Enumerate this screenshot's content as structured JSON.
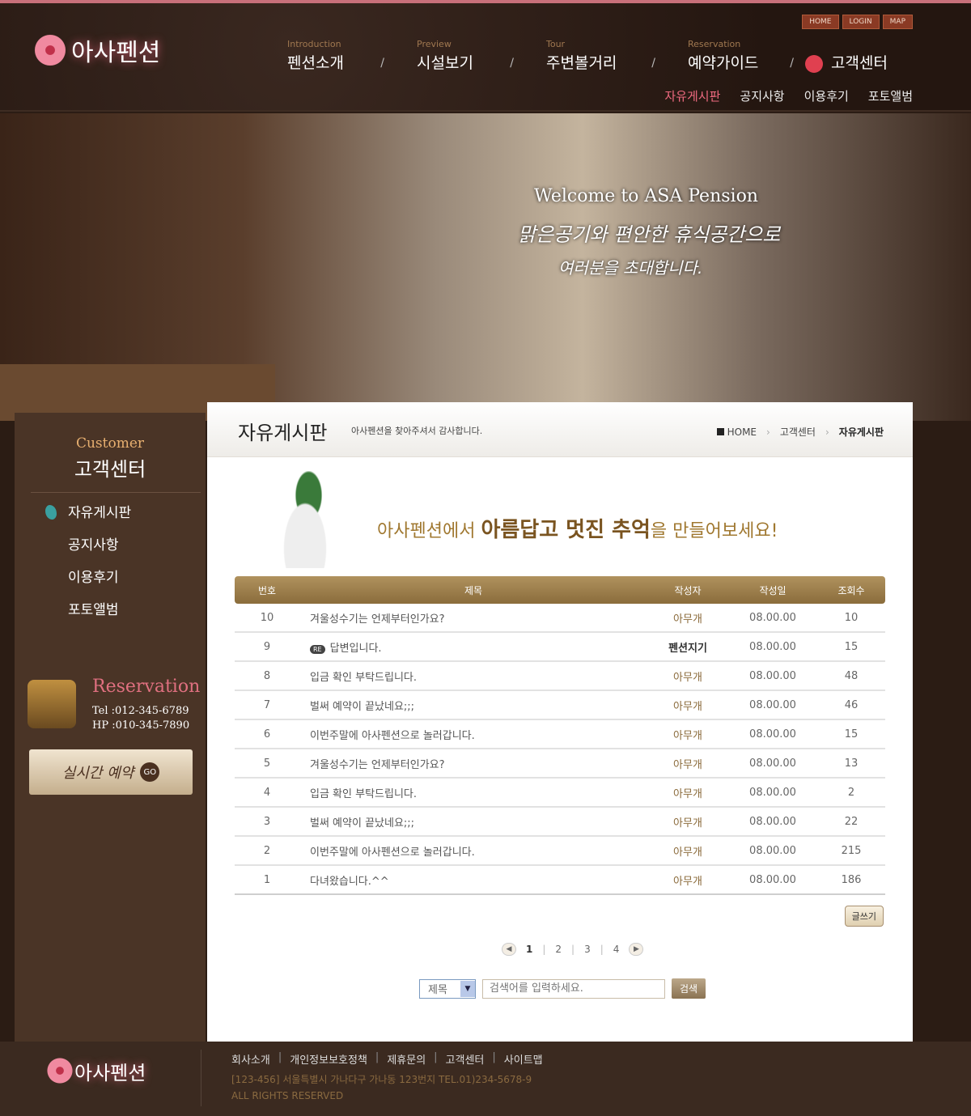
{
  "header": {
    "logo": "아사펜션",
    "utils": [
      "HOME",
      "LOGIN",
      "MAP"
    ],
    "nav": [
      {
        "en": "Introduction",
        "ko": "펜션소개"
      },
      {
        "en": "Preview",
        "ko": "시설보기"
      },
      {
        "en": "Tour",
        "ko": "주변볼거리"
      },
      {
        "en": "Reservation",
        "ko": "예약가이드"
      },
      {
        "en": "",
        "ko": "고객센터"
      }
    ],
    "subnav": [
      "자유게시판",
      "공지사항",
      "이용후기",
      "포토앨범"
    ]
  },
  "banner": {
    "welcome": "Welcome to ASA Pension",
    "line1": "맑은공기와 편안한 휴식공간으로",
    "line2": "여러분을 초대합니다."
  },
  "sidebar": {
    "title_en": "Customer",
    "title_ko": "고객센터",
    "menu": [
      "자유게시판",
      "공지사항",
      "이용후기",
      "포토앨범"
    ],
    "reservation": {
      "title": "Reservation",
      "tel": "Tel :012-345-6789",
      "hp": "HP :010-345-7890"
    },
    "realtime_button": "실시간 예약",
    "go": "GO"
  },
  "board": {
    "title": "자유게시판",
    "subtitle": "아사펜션을 찾아주셔서 감사합니다.",
    "breadcrumb": [
      "HOME",
      "고객센터",
      "자유게시판"
    ],
    "promo": {
      "pre": "아사펜션에서 ",
      "bold": "아름답고 멋진 추억",
      "post": "을 만들어보세요!"
    },
    "columns": [
      "번호",
      "제목",
      "작성자",
      "작성일",
      "조회수"
    ],
    "rows": [
      {
        "no": "10",
        "title": "겨울성수기는 언제부터인가요?",
        "author": "아무개",
        "date": "08.00.00",
        "views": "10"
      },
      {
        "no": "9",
        "re": "RE",
        "title": "답변입니다.",
        "author": "펜션지기",
        "date": "08.00.00",
        "views": "15"
      },
      {
        "no": "8",
        "title": "입금 확인 부탁드립니다.",
        "author": "아무개",
        "date": "08.00.00",
        "views": "48"
      },
      {
        "no": "7",
        "title": "벌써 예약이 끝났네요;;;",
        "author": "아무개",
        "date": "08.00.00",
        "views": "46"
      },
      {
        "no": "6",
        "title": "이번주말에 아사펜션으로 놀러갑니다.",
        "author": "아무개",
        "date": "08.00.00",
        "views": "15"
      },
      {
        "no": "5",
        "title": "겨울성수기는 언제부터인가요?",
        "author": "아무개",
        "date": "08.00.00",
        "views": "13"
      },
      {
        "no": "4",
        "title": "입금 확인 부탁드립니다.",
        "author": "아무개",
        "date": "08.00.00",
        "views": "2"
      },
      {
        "no": "3",
        "title": "벌써 예약이 끝났네요;;;",
        "author": "아무개",
        "date": "08.00.00",
        "views": "22"
      },
      {
        "no": "2",
        "title": "이번주말에 아사펜션으로 놀러갑니다.",
        "author": "아무개",
        "date": "08.00.00",
        "views": "215"
      },
      {
        "no": "1",
        "title": "다녀왔습니다.^^",
        "author": "아무개",
        "date": "08.00.00",
        "views": "186"
      }
    ],
    "write_button": "글쓰기",
    "pages": [
      "1",
      "2",
      "3",
      "4"
    ],
    "current_page": "1",
    "search": {
      "field": "제목",
      "placeholder": "검색어를 입력하세요.",
      "button": "검색"
    }
  },
  "footer": {
    "links": [
      "회사소개",
      "개인정보보호정책",
      "제휴문의",
      "고객센터",
      "사이트맵"
    ],
    "address": "[123-456] 서울특별시 가나다구 가나동 123번지 TEL.01)234-5678-9",
    "copyright": "ALL RIGHTS RESERVED"
  },
  "colors": {
    "accent": "#8a6c3c",
    "active_pink": "#ef6a80",
    "bg": "#2b1c14"
  }
}
